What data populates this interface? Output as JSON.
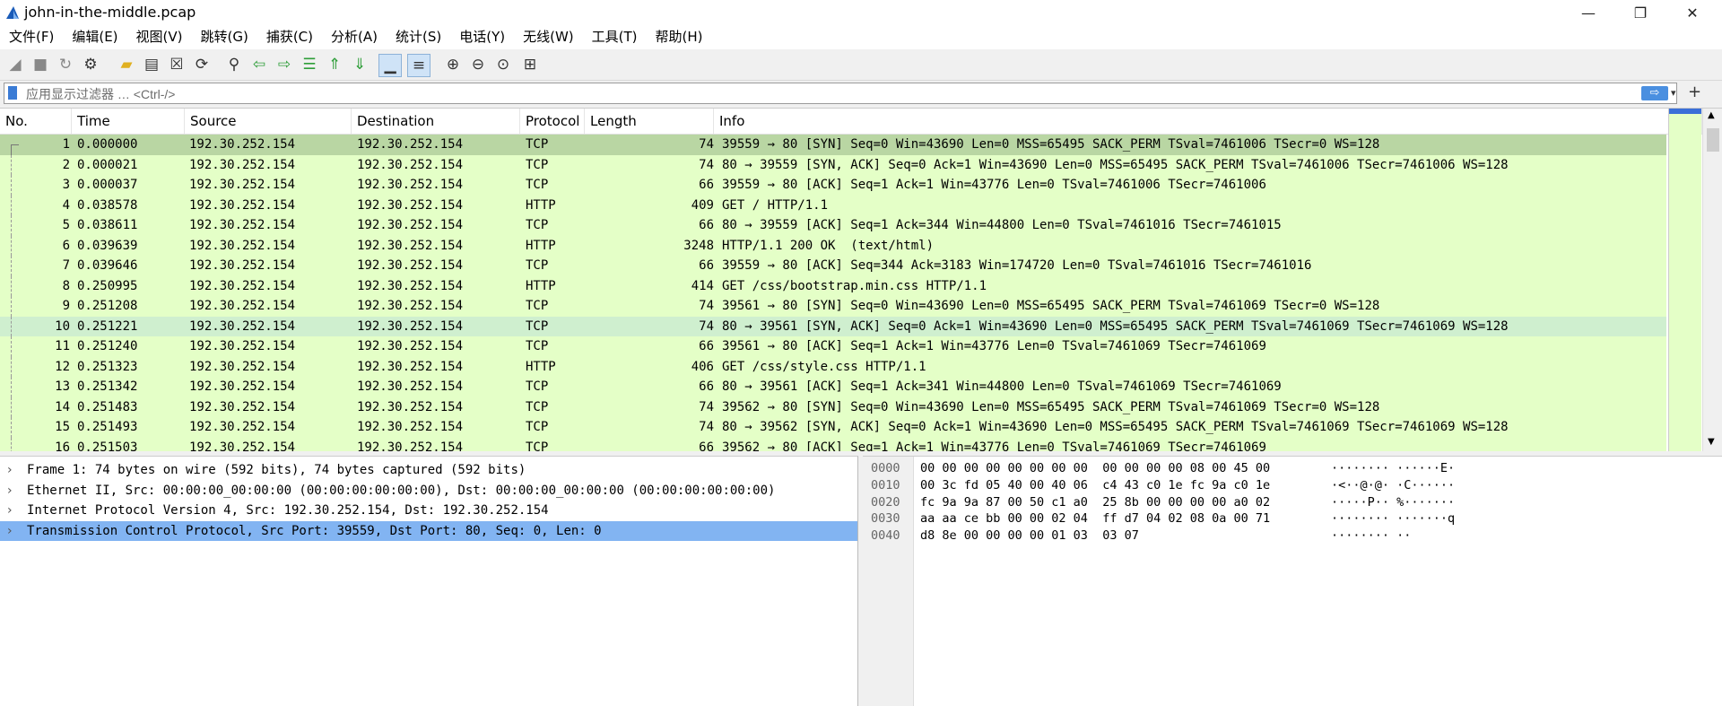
{
  "window": {
    "title": "john-in-the-middle.pcap",
    "minimize_glyph": "—",
    "maximize_glyph": "❐",
    "close_glyph": "✕"
  },
  "menu": [
    "文件(F)",
    "编辑(E)",
    "视图(V)",
    "跳转(G)",
    "捕获(C)",
    "分析(A)",
    "统计(S)",
    "电话(Y)",
    "无线(W)",
    "工具(T)",
    "帮助(H)"
  ],
  "toolbar_icons": [
    "shark-fin-start-icon",
    "stop-icon",
    "restart-icon",
    "options-gear-icon",
    "open-folder-icon",
    "save-file-icon",
    "close-file-icon",
    "reload-icon",
    "find-icon",
    "go-back-icon",
    "go-forward-icon",
    "go-to-packet-icon",
    "go-first-icon",
    "go-last-icon",
    "autoscroll-icon",
    "colorize-icon",
    "zoom-in-icon",
    "zoom-out-icon",
    "zoom-normal-icon",
    "resize-columns-icon"
  ],
  "filter": {
    "placeholder": "应用显示过滤器 … <Ctrl-/>",
    "apply_glyph": "⇨",
    "dropdown_glyph": "▾",
    "plus_glyph": "+"
  },
  "columns": [
    "No.",
    "Time",
    "Source",
    "Destination",
    "Protocol",
    "Length",
    "Info"
  ],
  "packets": [
    {
      "no": "1",
      "time": "0.000000",
      "src": "192.30.252.154",
      "dst": "192.30.252.154",
      "proto": "TCP",
      "len": "74",
      "info": "39559 → 80 [SYN] Seq=0 Win=43690 Len=0 MSS=65495 SACK_PERM TSval=7461006 TSecr=0 WS=128",
      "state": "selected"
    },
    {
      "no": "2",
      "time": "0.000021",
      "src": "192.30.252.154",
      "dst": "192.30.252.154",
      "proto": "TCP",
      "len": "74",
      "info": "80 → 39559 [SYN, ACK] Seq=0 Ack=1 Win=43690 Len=0 MSS=65495 SACK_PERM TSval=7461006 TSecr=7461006 WS=128",
      "state": ""
    },
    {
      "no": "3",
      "time": "0.000037",
      "src": "192.30.252.154",
      "dst": "192.30.252.154",
      "proto": "TCP",
      "len": "66",
      "info": "39559 → 80 [ACK] Seq=1 Ack=1 Win=43776 Len=0 TSval=7461006 TSecr=7461006",
      "state": ""
    },
    {
      "no": "4",
      "time": "0.038578",
      "src": "192.30.252.154",
      "dst": "192.30.252.154",
      "proto": "HTTP",
      "len": "409",
      "info": "GET / HTTP/1.1",
      "state": ""
    },
    {
      "no": "5",
      "time": "0.038611",
      "src": "192.30.252.154",
      "dst": "192.30.252.154",
      "proto": "TCP",
      "len": "66",
      "info": "80 → 39559 [ACK] Seq=1 Ack=344 Win=44800 Len=0 TSval=7461016 TSecr=7461015",
      "state": ""
    },
    {
      "no": "6",
      "time": "0.039639",
      "src": "192.30.252.154",
      "dst": "192.30.252.154",
      "proto": "HTTP",
      "len": "3248",
      "info": "HTTP/1.1 200 OK  (text/html)",
      "state": ""
    },
    {
      "no": "7",
      "time": "0.039646",
      "src": "192.30.252.154",
      "dst": "192.30.252.154",
      "proto": "TCP",
      "len": "66",
      "info": "39559 → 80 [ACK] Seq=344 Ack=3183 Win=174720 Len=0 TSval=7461016 TSecr=7461016",
      "state": ""
    },
    {
      "no": "8",
      "time": "0.250995",
      "src": "192.30.252.154",
      "dst": "192.30.252.154",
      "proto": "HTTP",
      "len": "414",
      "info": "GET /css/bootstrap.min.css HTTP/1.1",
      "state": ""
    },
    {
      "no": "9",
      "time": "0.251208",
      "src": "192.30.252.154",
      "dst": "192.30.252.154",
      "proto": "TCP",
      "len": "74",
      "info": "39561 → 80 [SYN] Seq=0 Win=43690 Len=0 MSS=65495 SACK_PERM TSval=7461069 TSecr=0 WS=128",
      "state": ""
    },
    {
      "no": "10",
      "time": "0.251221",
      "src": "192.30.252.154",
      "dst": "192.30.252.154",
      "proto": "TCP",
      "len": "74",
      "info": "80 → 39561 [SYN, ACK] Seq=0 Ack=1 Win=43690 Len=0 MSS=65495 SACK_PERM TSval=7461069 TSecr=7461069 WS=128",
      "state": "hover"
    },
    {
      "no": "11",
      "time": "0.251240",
      "src": "192.30.252.154",
      "dst": "192.30.252.154",
      "proto": "TCP",
      "len": "66",
      "info": "39561 → 80 [ACK] Seq=1 Ack=1 Win=43776 Len=0 TSval=7461069 TSecr=7461069",
      "state": ""
    },
    {
      "no": "12",
      "time": "0.251323",
      "src": "192.30.252.154",
      "dst": "192.30.252.154",
      "proto": "HTTP",
      "len": "406",
      "info": "GET /css/style.css HTTP/1.1",
      "state": ""
    },
    {
      "no": "13",
      "time": "0.251342",
      "src": "192.30.252.154",
      "dst": "192.30.252.154",
      "proto": "TCP",
      "len": "66",
      "info": "80 → 39561 [ACK] Seq=1 Ack=341 Win=44800 Len=0 TSval=7461069 TSecr=7461069",
      "state": ""
    },
    {
      "no": "14",
      "time": "0.251483",
      "src": "192.30.252.154",
      "dst": "192.30.252.154",
      "proto": "TCP",
      "len": "74",
      "info": "39562 → 80 [SYN] Seq=0 Win=43690 Len=0 MSS=65495 SACK_PERM TSval=7461069 TSecr=0 WS=128",
      "state": ""
    },
    {
      "no": "15",
      "time": "0.251493",
      "src": "192.30.252.154",
      "dst": "192.30.252.154",
      "proto": "TCP",
      "len": "74",
      "info": "80 → 39562 [SYN, ACK] Seq=0 Ack=1 Win=43690 Len=0 MSS=65495 SACK_PERM TSval=7461069 TSecr=7461069 WS=128",
      "state": ""
    },
    {
      "no": "16",
      "time": "0.251503",
      "src": "192.30.252.154",
      "dst": "192.30.252.154",
      "proto": "TCP",
      "len": "66",
      "info": "39562 → 80 [ACK] Seq=1 Ack=1 Win=43776 Len=0 TSval=7461069 TSecr=7461069",
      "state": ""
    }
  ],
  "details": [
    {
      "text": "Frame 1: 74 bytes on wire (592 bits), 74 bytes captured (592 bits)",
      "selected": false
    },
    {
      "text": "Ethernet II, Src: 00:00:00_00:00:00 (00:00:00:00:00:00), Dst: 00:00:00_00:00:00 (00:00:00:00:00:00)",
      "selected": false
    },
    {
      "text": "Internet Protocol Version 4, Src: 192.30.252.154, Dst: 192.30.252.154",
      "selected": false
    },
    {
      "text": "Transmission Control Protocol, Src Port: 39559, Dst Port: 80, Seq: 0, Len: 0",
      "selected": true
    }
  ],
  "expander_glyph": "›",
  "bytes": [
    {
      "offset": "0000",
      "hex": "00 00 00 00 00 00 00 00  00 00 00 00 08 00 45 00",
      "ascii": "········ ······E·"
    },
    {
      "offset": "0010",
      "hex": "00 3c fd 05 40 00 40 06  c4 43 c0 1e fc 9a c0 1e",
      "ascii": "·<··@·@· ·C······"
    },
    {
      "offset": "0020",
      "hex": "fc 9a 9a 87 00 50 c1 a0  25 8b 00 00 00 00 a0 02",
      "ascii": "·····P·· %·······"
    },
    {
      "offset": "0030",
      "hex": "aa aa ce bb 00 00 02 04  ff d7 04 02 08 0a 00 71",
      "ascii": "········ ·······q"
    },
    {
      "offset": "0040",
      "hex": "d8 8e 00 00 00 00 01 03  03 07",
      "ascii": "········ ··"
    }
  ],
  "colors": {
    "row_default": "#e4ffc7",
    "row_selected": "#b9d6a3",
    "row_hover": "#cfefcf",
    "detail_selected": "#82b4f2"
  }
}
